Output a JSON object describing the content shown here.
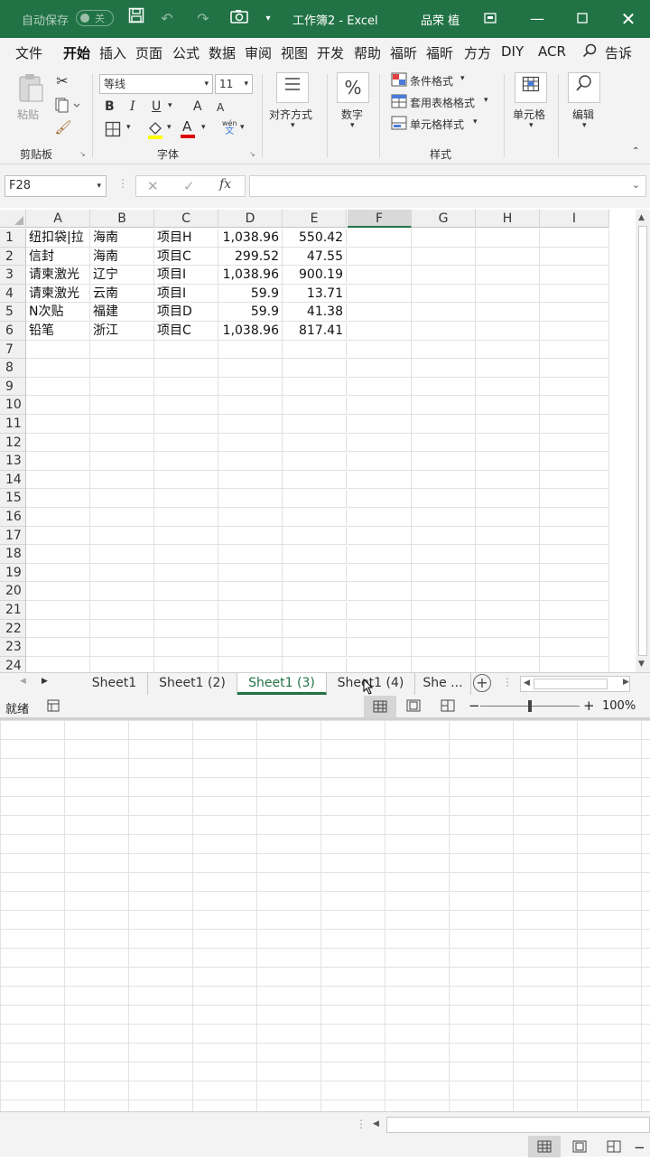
{
  "title": {
    "autosave_label": "自动保存",
    "autosave_state": "关",
    "workbook": "工作簿2  -  Excel",
    "user": "品荣 植"
  },
  "tabs": [
    "文件",
    "开始",
    "插入",
    "页面",
    "公式",
    "数据",
    "审阅",
    "视图",
    "开发",
    "帮助",
    "福昕",
    "福昕",
    "方方",
    "DIY",
    "ACR",
    "告诉"
  ],
  "ribbon": {
    "paste": "粘贴",
    "clipboard": "剪贴板",
    "font_name": "等线",
    "font_size": "11",
    "bold": "B",
    "italic": "I",
    "underline": "U",
    "grow": "A",
    "shrink": "A",
    "wen": "wén",
    "wen2": "文",
    "font_group": "字体",
    "align": "对齐方式",
    "number": "数字",
    "cond_format": "条件格式",
    "table_format": "套用表格格式",
    "cell_style": "单元格样式",
    "styles_group": "样式",
    "cells": "单元格",
    "edit": "编辑"
  },
  "formula_bar": {
    "name_box": "F28",
    "fx": "fx",
    "content": ""
  },
  "columns": [
    "A",
    "B",
    "C",
    "D",
    "E",
    "F",
    "G",
    "H",
    "I"
  ],
  "selected_column": "F",
  "rows": [
    [
      "纽扣袋|拉",
      "海南",
      "项目H",
      "1,038.96",
      "550.42"
    ],
    [
      "信封",
      "海南",
      "项目C",
      "299.52",
      "47.55"
    ],
    [
      "请柬激光",
      "辽宁",
      "项目I",
      "1,038.96",
      "900.19"
    ],
    [
      "请柬激光",
      "云南",
      "项目I",
      "59.9",
      "13.71"
    ],
    [
      "N次贴",
      "福建",
      "项目D",
      "59.9",
      "41.38"
    ],
    [
      "铅笔",
      "浙江",
      "项目C",
      "1,038.96",
      "817.41"
    ]
  ],
  "row_numbers": [
    "1",
    "2",
    "3",
    "4",
    "5",
    "6",
    "7",
    "8",
    "9",
    "10",
    "11",
    "12",
    "13",
    "14",
    "15",
    "16",
    "17",
    "18",
    "19",
    "20",
    "21",
    "22",
    "23",
    "24"
  ],
  "sheets": [
    "Sheet1",
    "Sheet1 (2)",
    "Sheet1 (3)",
    "Sheet1 (4)",
    "She ..."
  ],
  "active_sheet": "Sheet1 (3)",
  "status": {
    "ready": "就绪",
    "zoom": "100%",
    "minus": "−",
    "plus": "+"
  },
  "colors": {
    "brand": "#217346",
    "ribbon_bg": "#f3f3f3"
  },
  "icons": [
    "save-icon",
    "undo-icon",
    "redo-icon",
    "camera-icon",
    "ribbon-display-icon",
    "minimize-icon",
    "maximize-icon",
    "close-icon",
    "search-icon",
    "paste-icon",
    "cut-icon",
    "copy-icon",
    "format-painter-icon",
    "border-icon",
    "fill-color-icon",
    "font-color-icon",
    "align-icon",
    "percent-icon",
    "cells-icon",
    "search-edit-icon",
    "cancel-icon",
    "check-icon",
    "add-sheet-icon",
    "normal-view-icon",
    "page-layout-icon",
    "page-break-icon"
  ]
}
